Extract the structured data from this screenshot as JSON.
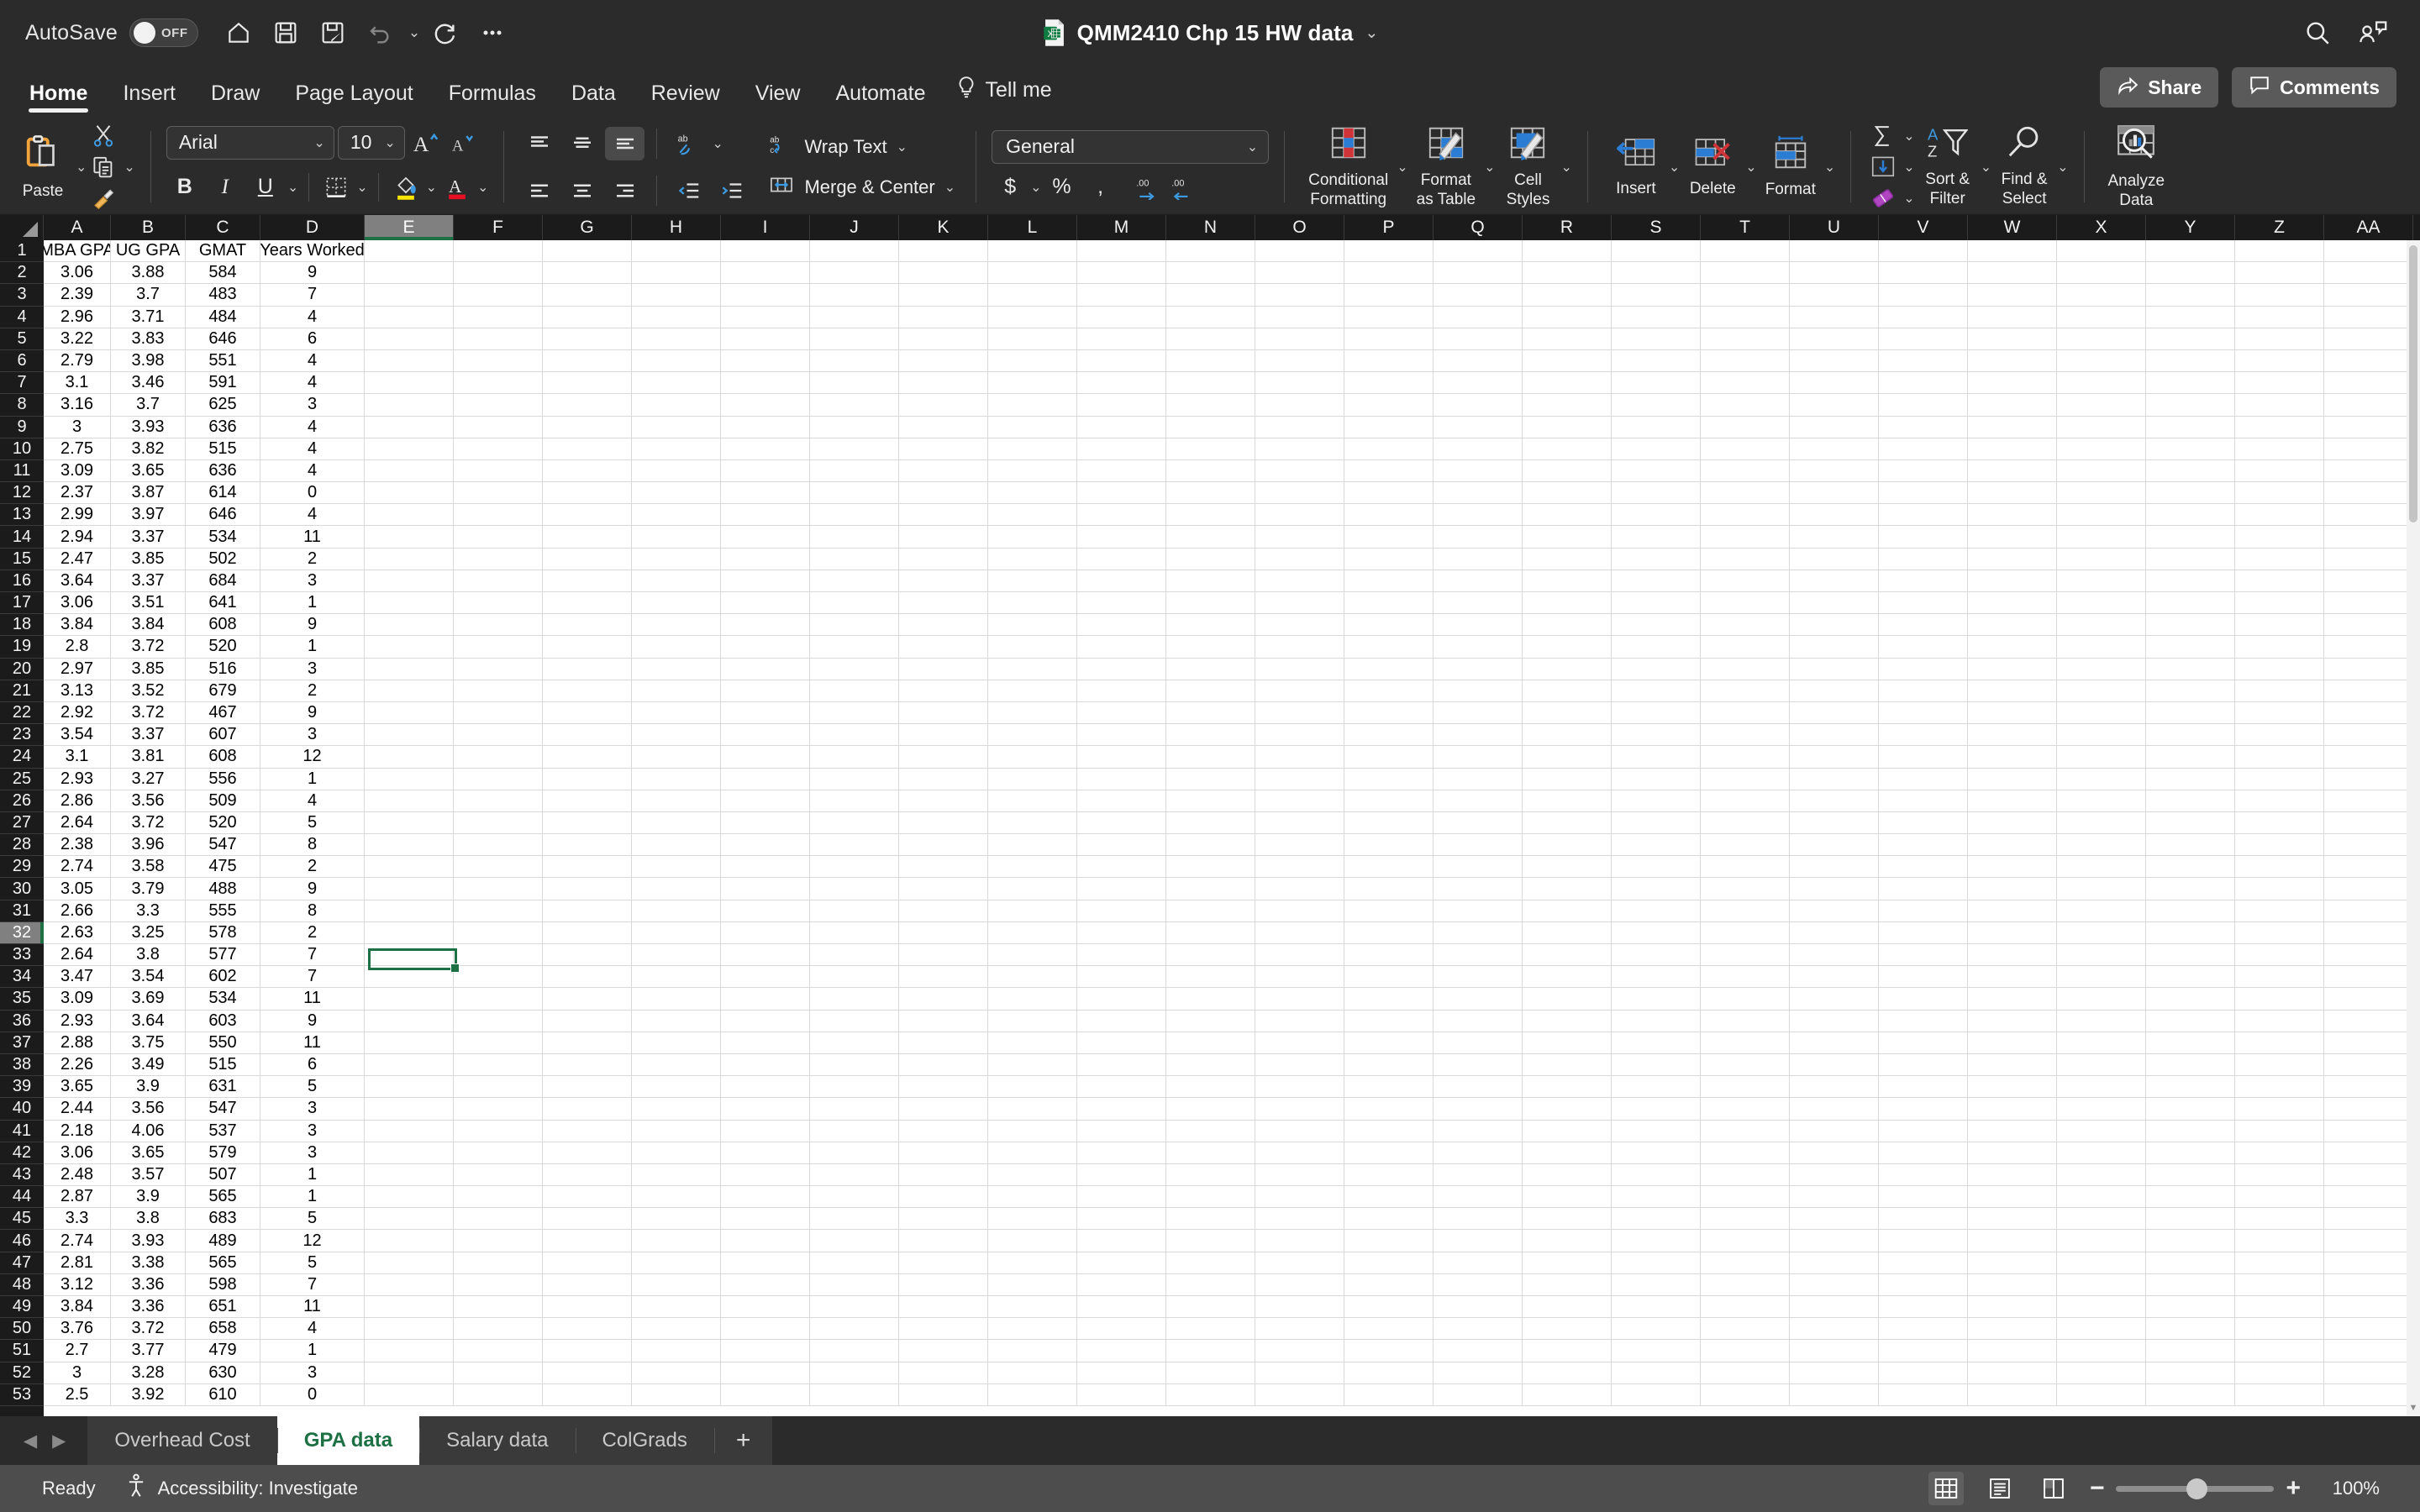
{
  "titlebar": {
    "autosave_label": "AutoSave",
    "autosave_state": "OFF",
    "doc_title": "QMM2410 Chp 15 HW data",
    "quick_access": [
      "home-icon",
      "save-icon",
      "save-as-icon",
      "undo-icon",
      "redo-icon",
      "more-icon"
    ],
    "right_icons": [
      "search-icon",
      "collaborators-icon"
    ]
  },
  "ribbon_tabs": [
    {
      "label": "Home",
      "active": true
    },
    {
      "label": "Insert",
      "active": false
    },
    {
      "label": "Draw",
      "active": false
    },
    {
      "label": "Page Layout",
      "active": false
    },
    {
      "label": "Formulas",
      "active": false
    },
    {
      "label": "Data",
      "active": false
    },
    {
      "label": "Review",
      "active": false
    },
    {
      "label": "View",
      "active": false
    },
    {
      "label": "Automate",
      "active": false
    }
  ],
  "tell_me": {
    "label": "Tell me",
    "icon": "lightbulb-icon"
  },
  "share": {
    "label": "Share",
    "icon": "share-icon"
  },
  "comments": {
    "label": "Comments",
    "icon": "comment-icon"
  },
  "ribbon": {
    "clipboard": {
      "paste_label": "Paste",
      "cut_icon": "scissors-icon",
      "copy_icon": "copy-icon",
      "format_painter_icon": "format-painter-icon"
    },
    "font": {
      "font_name": "Arial",
      "font_size": "10",
      "grow_font_icon": "increase-font-size-icon",
      "shrink_font_icon": "decrease-font-size-icon",
      "bold": "B",
      "italic": "I",
      "underline": "U",
      "borders_icon": "borders-icon",
      "fill_color_icon": "fill-color-icon",
      "font_color_icon": "font-color-icon"
    },
    "alignment": {
      "wrap_text_label": "Wrap Text",
      "merge_center_label": "Merge & Center",
      "orientation_icon": "orientation-icon",
      "decrease_indent_icon": "decrease-indent-icon",
      "increase_indent_icon": "increase-indent-icon"
    },
    "number": {
      "format": "General",
      "currency_icon": "currency-icon",
      "percent_icon": "percent-icon",
      "comma_icon": "comma-style-icon",
      "increase_decimal_icon": "increase-decimal-icon",
      "decrease_decimal_icon": "decrease-decimal-icon"
    },
    "styles": [
      {
        "label": "Conditional\nFormatting",
        "line1": "Conditional",
        "line2": "Formatting"
      },
      {
        "label": "Format as Table",
        "line1": "Format",
        "line2": "as Table"
      },
      {
        "label": "Cell Styles",
        "line1": "Cell",
        "line2": "Styles"
      }
    ],
    "cells": [
      {
        "label": "Insert"
      },
      {
        "label": "Delete"
      },
      {
        "label": "Format"
      }
    ],
    "editing": {
      "autosum_icon": "autosum-icon",
      "fill_icon": "fill-icon",
      "clear_icon": "clear-icon",
      "sort_filter_line1": "Sort &",
      "sort_filter_line2": "Filter",
      "find_select_line1": "Find &",
      "find_select_line2": "Select"
    },
    "analyze": {
      "line1": "Analyze",
      "line2": "Data"
    }
  },
  "grid": {
    "column_letters": [
      "A",
      "B",
      "C",
      "D",
      "E",
      "F",
      "G",
      "H",
      "I",
      "J",
      "K",
      "L",
      "M",
      "N",
      "O",
      "P",
      "Q",
      "R",
      "S",
      "T",
      "U",
      "V",
      "W",
      "X",
      "Y",
      "Z",
      "AA"
    ],
    "selected_column": "E",
    "selected_row": 32,
    "selected_cell": "E32",
    "headers": [
      "MBA GPA",
      "UG GPA",
      "GMAT",
      "Years Worked"
    ],
    "rows": [
      [
        "3.06",
        "3.88",
        "584",
        "9"
      ],
      [
        "2.39",
        "3.7",
        "483",
        "7"
      ],
      [
        "2.96",
        "3.71",
        "484",
        "4"
      ],
      [
        "3.22",
        "3.83",
        "646",
        "6"
      ],
      [
        "2.79",
        "3.98",
        "551",
        "4"
      ],
      [
        "3.1",
        "3.46",
        "591",
        "4"
      ],
      [
        "3.16",
        "3.7",
        "625",
        "3"
      ],
      [
        "3",
        "3.93",
        "636",
        "4"
      ],
      [
        "2.75",
        "3.82",
        "515",
        "4"
      ],
      [
        "3.09",
        "3.65",
        "636",
        "4"
      ],
      [
        "2.37",
        "3.87",
        "614",
        "0"
      ],
      [
        "2.99",
        "3.97",
        "646",
        "4"
      ],
      [
        "2.94",
        "3.37",
        "534",
        "11"
      ],
      [
        "2.47",
        "3.85",
        "502",
        "2"
      ],
      [
        "3.64",
        "3.37",
        "684",
        "3"
      ],
      [
        "3.06",
        "3.51",
        "641",
        "1"
      ],
      [
        "3.84",
        "3.84",
        "608",
        "9"
      ],
      [
        "2.8",
        "3.72",
        "520",
        "1"
      ],
      [
        "2.97",
        "3.85",
        "516",
        "3"
      ],
      [
        "3.13",
        "3.52",
        "679",
        "2"
      ],
      [
        "2.92",
        "3.72",
        "467",
        "9"
      ],
      [
        "3.54",
        "3.37",
        "607",
        "3"
      ],
      [
        "3.1",
        "3.81",
        "608",
        "12"
      ],
      [
        "2.93",
        "3.27",
        "556",
        "1"
      ],
      [
        "2.86",
        "3.56",
        "509",
        "4"
      ],
      [
        "2.64",
        "3.72",
        "520",
        "5"
      ],
      [
        "2.38",
        "3.96",
        "547",
        "8"
      ],
      [
        "2.74",
        "3.58",
        "475",
        "2"
      ],
      [
        "3.05",
        "3.79",
        "488",
        "9"
      ],
      [
        "2.66",
        "3.3",
        "555",
        "8"
      ],
      [
        "2.63",
        "3.25",
        "578",
        "2"
      ],
      [
        "2.64",
        "3.8",
        "577",
        "7"
      ],
      [
        "3.47",
        "3.54",
        "602",
        "7"
      ],
      [
        "3.09",
        "3.69",
        "534",
        "11"
      ],
      [
        "2.93",
        "3.64",
        "603",
        "9"
      ],
      [
        "2.88",
        "3.75",
        "550",
        "11"
      ],
      [
        "2.26",
        "3.49",
        "515",
        "6"
      ],
      [
        "3.65",
        "3.9",
        "631",
        "5"
      ],
      [
        "2.44",
        "3.56",
        "547",
        "3"
      ],
      [
        "2.18",
        "4.06",
        "537",
        "3"
      ],
      [
        "3.06",
        "3.65",
        "579",
        "3"
      ],
      [
        "2.48",
        "3.57",
        "507",
        "1"
      ],
      [
        "2.87",
        "3.9",
        "565",
        "1"
      ],
      [
        "3.3",
        "3.8",
        "683",
        "5"
      ],
      [
        "2.74",
        "3.93",
        "489",
        "12"
      ],
      [
        "2.81",
        "3.38",
        "565",
        "5"
      ],
      [
        "3.12",
        "3.36",
        "598",
        "7"
      ],
      [
        "3.84",
        "3.36",
        "651",
        "11"
      ],
      [
        "3.76",
        "3.72",
        "658",
        "4"
      ],
      [
        "2.7",
        "3.77",
        "479",
        "1"
      ],
      [
        "3",
        "3.28",
        "630",
        "3"
      ],
      [
        "2.5",
        "3.92",
        "610",
        "0"
      ]
    ]
  },
  "sheet_tabs": [
    {
      "label": "Overhead Cost",
      "active": false
    },
    {
      "label": "GPA data",
      "active": true
    },
    {
      "label": "Salary data",
      "active": false
    },
    {
      "label": "ColGrads",
      "active": false
    }
  ],
  "add_sheet_label": "+",
  "statusbar": {
    "state": "Ready",
    "accessibility": "Accessibility: Investigate",
    "views": [
      "normal-view-icon",
      "page-layout-view-icon",
      "page-break-view-icon"
    ],
    "zoom_out": "−",
    "zoom_in": "+",
    "zoom_level": "100%"
  },
  "colors": {
    "accent_green": "#1d7044",
    "chrome_dark": "#2b2b2b",
    "grid_line": "#d9d9d9",
    "header_dark": "#1b1b1b",
    "status_gray": "#4d4d4d"
  }
}
